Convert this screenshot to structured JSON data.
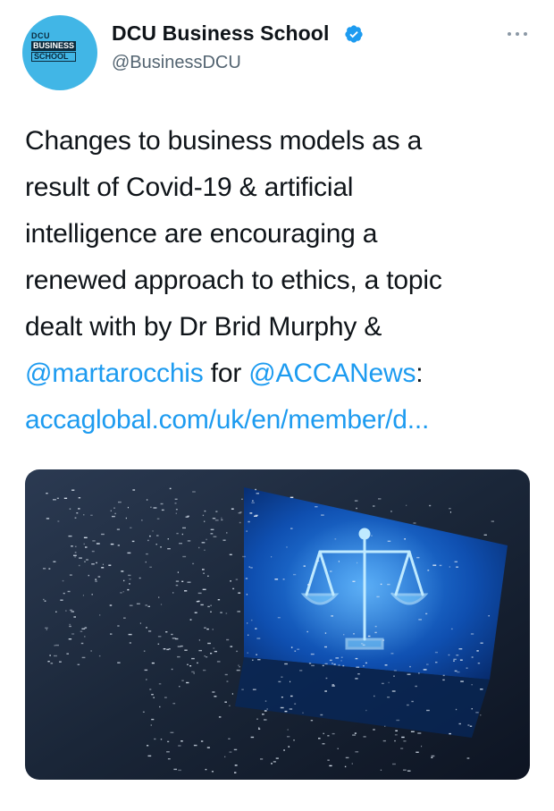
{
  "author": {
    "display_name": "DCU Business School",
    "handle": "@BusinessDCU",
    "avatar_text": [
      "DCU",
      "BUSINESS",
      "SCHOOL"
    ],
    "verified": true,
    "avatar_color": "#41b6e6"
  },
  "tweet": {
    "line1": "Changes to business models as a",
    "line2": "result of Covid-19 & artificial",
    "line3": "intelligence are encouraging a",
    "line4": "renewed approach to ethics, a topic",
    "line5": "dealt with by Dr Brid Murphy &",
    "mention1": "@martarocchis",
    "mid_text": " for ",
    "mention2": "@ACCANews",
    "colon": ":",
    "url": "accaglobal.com/uk/en/member/d..."
  },
  "colors": {
    "link": "#1d9bf0",
    "verified_badge": "#1d9bf0",
    "text": "#0f1419",
    "secondary": "#536471"
  },
  "icons": {
    "verified": "verified-badge-icon",
    "more": "more-dots-icon"
  }
}
